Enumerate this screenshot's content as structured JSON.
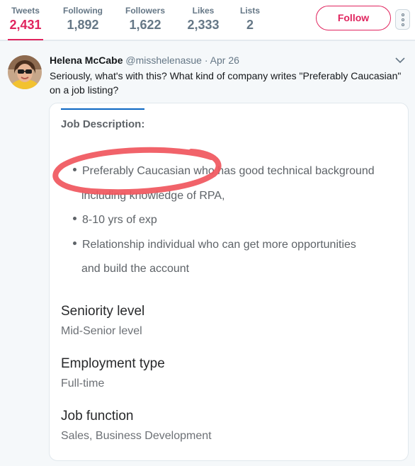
{
  "profile_stats": {
    "items": [
      {
        "label": "Tweets",
        "value": "2,431",
        "active": true
      },
      {
        "label": "Following",
        "value": "1,892"
      },
      {
        "label": "Followers",
        "value": "1,622"
      },
      {
        "label": "Likes",
        "value": "2,333"
      },
      {
        "label": "Lists",
        "value": "2"
      }
    ],
    "follow_label": "Follow",
    "accent_color": "#e0245e"
  },
  "tweet": {
    "author_name": "Helena McCabe",
    "author_handle": "@misshelenasue",
    "separator": "·",
    "timestamp": "Apr 26",
    "text": "Seriously, what's with this? What kind of company writes \"Preferably Caucasian\" on a job listing?",
    "avatar_icon": "user-photo-avatar",
    "menu_icon": "chevron-down-icon"
  },
  "job_image": {
    "heading": "Job Description:",
    "bullets": [
      {
        "line1": "Preferably Caucasian who has good technical background",
        "line2": "including knowledge of RPA,"
      },
      {
        "line1": "8-10 yrs of exp",
        "line2": ""
      },
      {
        "line1": "Relationship individual who can get more opportunities",
        "line2": "and build the account"
      }
    ],
    "sections": [
      {
        "title": "Seniority level",
        "value": "Mid-Senior level"
      },
      {
        "title": "Employment type",
        "value": "Full-time"
      },
      {
        "title": "Job function",
        "value": "Sales, Business Development"
      }
    ],
    "highlight_color": "#f0565d"
  }
}
